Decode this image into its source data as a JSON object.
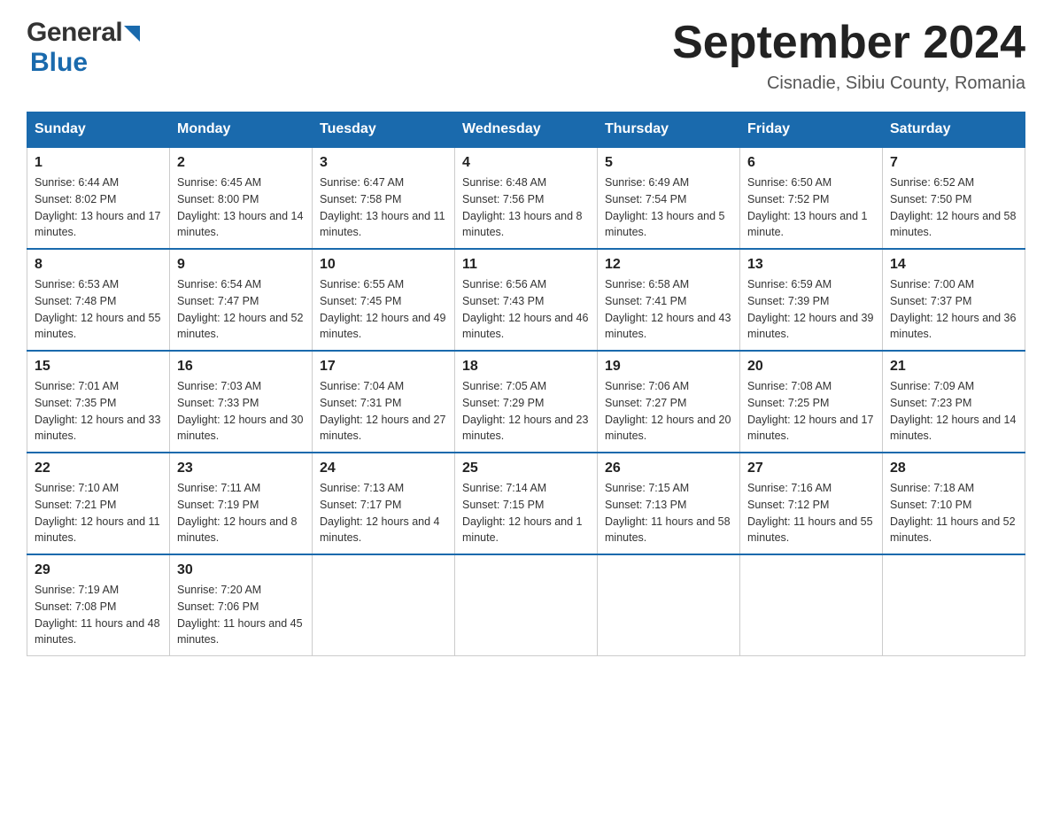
{
  "header": {
    "logo_general": "General",
    "logo_blue": "Blue",
    "title": "September 2024",
    "subtitle": "Cisnadie, Sibiu County, Romania"
  },
  "days_of_week": [
    "Sunday",
    "Monday",
    "Tuesday",
    "Wednesday",
    "Thursday",
    "Friday",
    "Saturday"
  ],
  "weeks": [
    [
      {
        "day": "1",
        "sunrise": "6:44 AM",
        "sunset": "8:02 PM",
        "daylight": "13 hours and 17 minutes."
      },
      {
        "day": "2",
        "sunrise": "6:45 AM",
        "sunset": "8:00 PM",
        "daylight": "13 hours and 14 minutes."
      },
      {
        "day": "3",
        "sunrise": "6:47 AM",
        "sunset": "7:58 PM",
        "daylight": "13 hours and 11 minutes."
      },
      {
        "day": "4",
        "sunrise": "6:48 AM",
        "sunset": "7:56 PM",
        "daylight": "13 hours and 8 minutes."
      },
      {
        "day": "5",
        "sunrise": "6:49 AM",
        "sunset": "7:54 PM",
        "daylight": "13 hours and 5 minutes."
      },
      {
        "day": "6",
        "sunrise": "6:50 AM",
        "sunset": "7:52 PM",
        "daylight": "13 hours and 1 minute."
      },
      {
        "day": "7",
        "sunrise": "6:52 AM",
        "sunset": "7:50 PM",
        "daylight": "12 hours and 58 minutes."
      }
    ],
    [
      {
        "day": "8",
        "sunrise": "6:53 AM",
        "sunset": "7:48 PM",
        "daylight": "12 hours and 55 minutes."
      },
      {
        "day": "9",
        "sunrise": "6:54 AM",
        "sunset": "7:47 PM",
        "daylight": "12 hours and 52 minutes."
      },
      {
        "day": "10",
        "sunrise": "6:55 AM",
        "sunset": "7:45 PM",
        "daylight": "12 hours and 49 minutes."
      },
      {
        "day": "11",
        "sunrise": "6:56 AM",
        "sunset": "7:43 PM",
        "daylight": "12 hours and 46 minutes."
      },
      {
        "day": "12",
        "sunrise": "6:58 AM",
        "sunset": "7:41 PM",
        "daylight": "12 hours and 43 minutes."
      },
      {
        "day": "13",
        "sunrise": "6:59 AM",
        "sunset": "7:39 PM",
        "daylight": "12 hours and 39 minutes."
      },
      {
        "day": "14",
        "sunrise": "7:00 AM",
        "sunset": "7:37 PM",
        "daylight": "12 hours and 36 minutes."
      }
    ],
    [
      {
        "day": "15",
        "sunrise": "7:01 AM",
        "sunset": "7:35 PM",
        "daylight": "12 hours and 33 minutes."
      },
      {
        "day": "16",
        "sunrise": "7:03 AM",
        "sunset": "7:33 PM",
        "daylight": "12 hours and 30 minutes."
      },
      {
        "day": "17",
        "sunrise": "7:04 AM",
        "sunset": "7:31 PM",
        "daylight": "12 hours and 27 minutes."
      },
      {
        "day": "18",
        "sunrise": "7:05 AM",
        "sunset": "7:29 PM",
        "daylight": "12 hours and 23 minutes."
      },
      {
        "day": "19",
        "sunrise": "7:06 AM",
        "sunset": "7:27 PM",
        "daylight": "12 hours and 20 minutes."
      },
      {
        "day": "20",
        "sunrise": "7:08 AM",
        "sunset": "7:25 PM",
        "daylight": "12 hours and 17 minutes."
      },
      {
        "day": "21",
        "sunrise": "7:09 AM",
        "sunset": "7:23 PM",
        "daylight": "12 hours and 14 minutes."
      }
    ],
    [
      {
        "day": "22",
        "sunrise": "7:10 AM",
        "sunset": "7:21 PM",
        "daylight": "12 hours and 11 minutes."
      },
      {
        "day": "23",
        "sunrise": "7:11 AM",
        "sunset": "7:19 PM",
        "daylight": "12 hours and 8 minutes."
      },
      {
        "day": "24",
        "sunrise": "7:13 AM",
        "sunset": "7:17 PM",
        "daylight": "12 hours and 4 minutes."
      },
      {
        "day": "25",
        "sunrise": "7:14 AM",
        "sunset": "7:15 PM",
        "daylight": "12 hours and 1 minute."
      },
      {
        "day": "26",
        "sunrise": "7:15 AM",
        "sunset": "7:13 PM",
        "daylight": "11 hours and 58 minutes."
      },
      {
        "day": "27",
        "sunrise": "7:16 AM",
        "sunset": "7:12 PM",
        "daylight": "11 hours and 55 minutes."
      },
      {
        "day": "28",
        "sunrise": "7:18 AM",
        "sunset": "7:10 PM",
        "daylight": "11 hours and 52 minutes."
      }
    ],
    [
      {
        "day": "29",
        "sunrise": "7:19 AM",
        "sunset": "7:08 PM",
        "daylight": "11 hours and 48 minutes."
      },
      {
        "day": "30",
        "sunrise": "7:20 AM",
        "sunset": "7:06 PM",
        "daylight": "11 hours and 45 minutes."
      },
      null,
      null,
      null,
      null,
      null
    ]
  ]
}
